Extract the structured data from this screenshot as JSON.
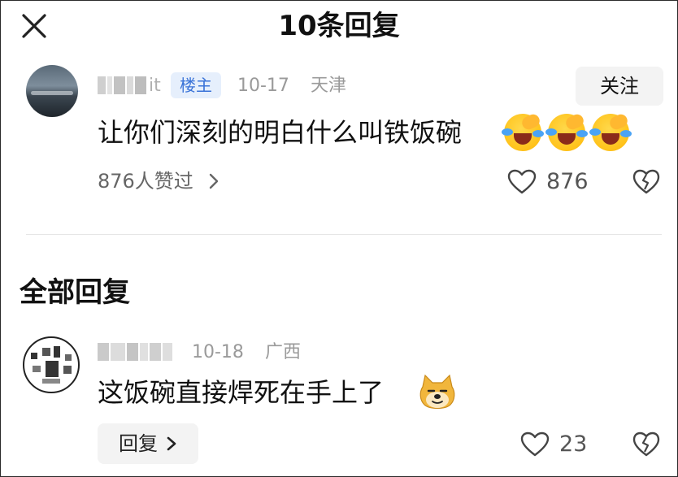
{
  "header": {
    "title": "10条回复",
    "close_icon": "close-icon"
  },
  "op_comment": {
    "avatar": "avatar",
    "username_visible_suffix": "it",
    "badge": "楼主",
    "date": "10-17",
    "location": "天津",
    "follow_label": "关注",
    "text": "让你们深刻的明白什么叫铁饭碗",
    "emojis": [
      "crying-laughing-emoji",
      "crying-laughing-emoji",
      "crying-laughing-emoji"
    ],
    "likes_summary": "876人赞过",
    "like_count": "876",
    "icons": {
      "like": "heart-icon",
      "dislike": "broken-heart-icon",
      "chevron": "chevron-right-icon"
    }
  },
  "section": {
    "title": "全部回复"
  },
  "reply": {
    "avatar": "avatar",
    "date": "10-18",
    "location": "广西",
    "text": "这饭碗直接焊死在手上了",
    "emoji": "doge-emoji",
    "reply_button_label": "回复",
    "like_count": "23",
    "icons": {
      "like": "heart-icon",
      "dislike": "broken-heart-icon",
      "chevron": "chevron-right-icon"
    }
  },
  "colors": {
    "badge_bg": "#e6effc",
    "badge_text": "#3a73d8",
    "meta_gray": "#9a9a9a",
    "button_bg": "#f3f3f3"
  }
}
